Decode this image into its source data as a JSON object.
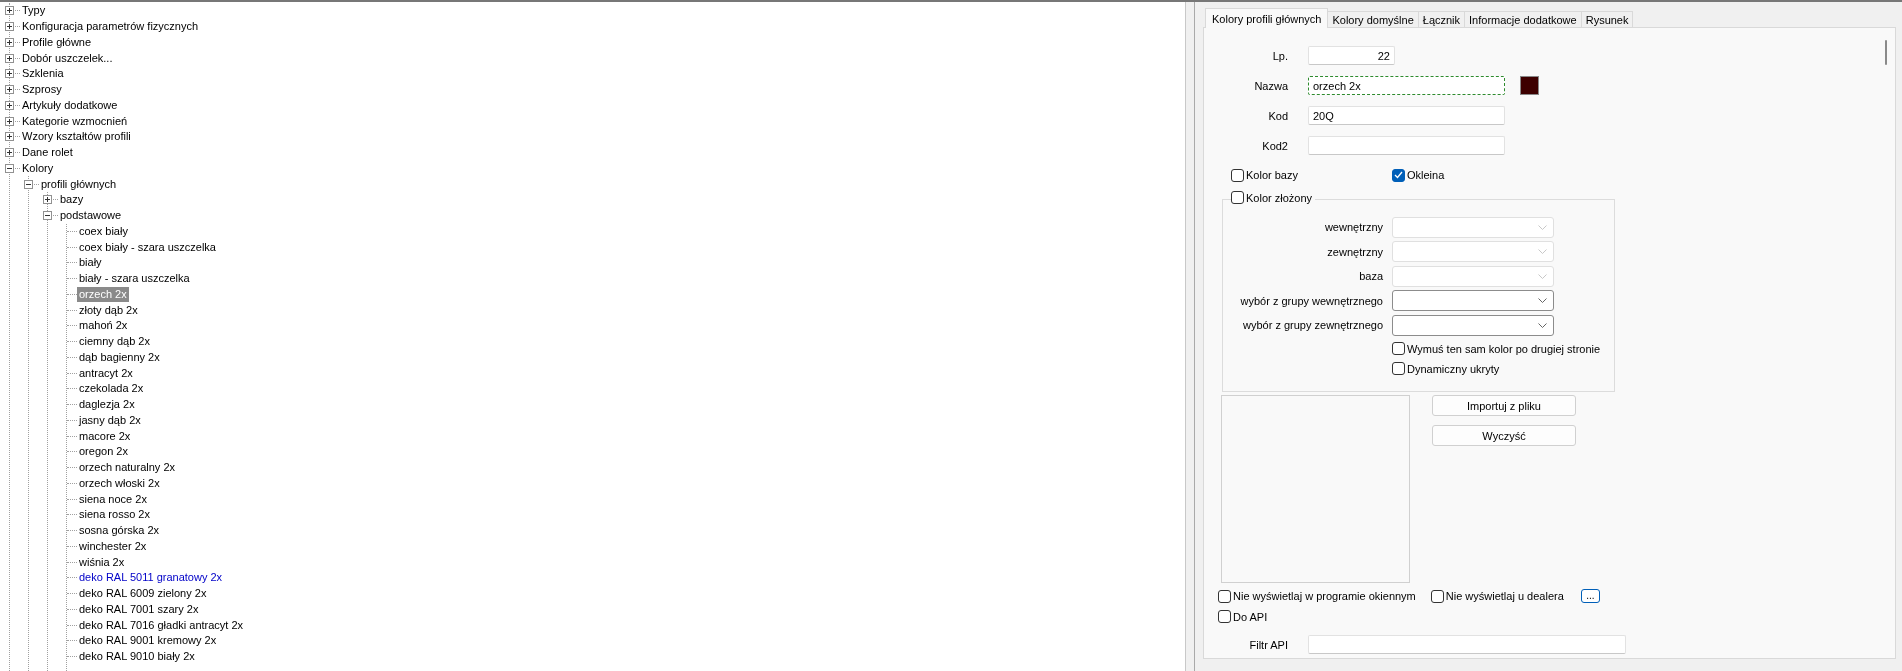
{
  "tree": [
    {
      "label": "Typy",
      "expanded": false,
      "selected": false,
      "highlighted": false
    },
    {
      "label": "Konfiguracja parametrów fizycznych",
      "expanded": false,
      "selected": false,
      "highlighted": false
    },
    {
      "label": "Profile główne",
      "expanded": false,
      "selected": false,
      "highlighted": false
    },
    {
      "label": "Dobór uszczelek...",
      "expanded": false,
      "selected": false,
      "highlighted": false
    },
    {
      "label": "Szklenia",
      "expanded": false,
      "selected": false,
      "highlighted": false
    },
    {
      "label": "Szprosy",
      "expanded": false,
      "selected": false,
      "highlighted": false
    },
    {
      "label": "Artykuły dodatkowe",
      "expanded": false,
      "selected": false,
      "highlighted": false
    },
    {
      "label": "Kategorie wzmocnień",
      "expanded": false,
      "selected": false,
      "highlighted": false
    },
    {
      "label": "Wzory kształtów profili",
      "expanded": false,
      "selected": false,
      "highlighted": false
    },
    {
      "label": "Dane rolet",
      "expanded": false,
      "selected": false,
      "highlighted": false
    },
    {
      "label": "Kolory",
      "expanded": true,
      "selected": false,
      "highlighted": false,
      "children": [
        {
          "label": "profili głównych",
          "expanded": true,
          "selected": false,
          "highlighted": false,
          "children": [
            {
              "label": "bazy",
              "expanded": false,
              "selected": false,
              "highlighted": false
            },
            {
              "label": "podstawowe",
              "expanded": true,
              "selected": false,
              "highlighted": false,
              "children": [
                {
                  "label": "coex biały",
                  "selected": false,
                  "highlighted": false
                },
                {
                  "label": "coex biały - szara uszczelka",
                  "selected": false,
                  "highlighted": false
                },
                {
                  "label": "biały",
                  "selected": false,
                  "highlighted": false
                },
                {
                  "label": "biały - szara uszczelka",
                  "selected": false,
                  "highlighted": false
                },
                {
                  "label": "orzech 2x",
                  "selected": true,
                  "highlighted": false
                },
                {
                  "label": "złoty dąb 2x",
                  "selected": false,
                  "highlighted": false
                },
                {
                  "label": "mahoń 2x",
                  "selected": false,
                  "highlighted": false
                },
                {
                  "label": "ciemny dąb 2x",
                  "selected": false,
                  "highlighted": false
                },
                {
                  "label": "dąb bagienny 2x",
                  "selected": false,
                  "highlighted": false
                },
                {
                  "label": "antracyt 2x",
                  "selected": false,
                  "highlighted": false
                },
                {
                  "label": "czekolada 2x",
                  "selected": false,
                  "highlighted": false
                },
                {
                  "label": "daglezja 2x",
                  "selected": false,
                  "highlighted": false
                },
                {
                  "label": "jasny dąb 2x",
                  "selected": false,
                  "highlighted": false
                },
                {
                  "label": "macore 2x",
                  "selected": false,
                  "highlighted": false
                },
                {
                  "label": "oregon 2x",
                  "selected": false,
                  "highlighted": false
                },
                {
                  "label": "orzech naturalny 2x",
                  "selected": false,
                  "highlighted": false
                },
                {
                  "label": "orzech włoski 2x",
                  "selected": false,
                  "highlighted": false
                },
                {
                  "label": "siena noce 2x",
                  "selected": false,
                  "highlighted": false
                },
                {
                  "label": "siena rosso 2x",
                  "selected": false,
                  "highlighted": false
                },
                {
                  "label": "sosna górska 2x",
                  "selected": false,
                  "highlighted": false
                },
                {
                  "label": "winchester 2x",
                  "selected": false,
                  "highlighted": false
                },
                {
                  "label": "wiśnia 2x",
                  "selected": false,
                  "highlighted": false
                },
                {
                  "label": "deko RAL 5011 granatowy 2x",
                  "selected": false,
                  "highlighted": true
                },
                {
                  "label": "deko RAL 6009 zielony 2x",
                  "selected": false,
                  "highlighted": false
                },
                {
                  "label": "deko RAL 7001 szary 2x",
                  "selected": false,
                  "highlighted": false
                },
                {
                  "label": "deko RAL 7016 gładki antracyt 2x",
                  "selected": false,
                  "highlighted": false
                },
                {
                  "label": "deko RAL 9001 kremowy 2x",
                  "selected": false,
                  "highlighted": false
                },
                {
                  "label": "deko RAL 9010 biały 2x",
                  "selected": false,
                  "highlighted": false
                }
              ]
            }
          ]
        }
      ]
    }
  ],
  "panel": {
    "tabs": [
      {
        "label": "Kolory profili głównych",
        "selected": true
      },
      {
        "label": "Kolory domyślne",
        "selected": false
      },
      {
        "label": "Łącznik",
        "selected": false
      },
      {
        "label": "Informacje dodatkowe",
        "selected": false
      },
      {
        "label": "Rysunek",
        "selected": false
      }
    ],
    "fields": [
      {
        "kind": "number",
        "label": "Lp.",
        "value": "22"
      },
      {
        "kind": "name",
        "label": "Nazwa",
        "value": "orzech 2x",
        "focused": true,
        "color": "#3d0000"
      },
      {
        "kind": "text",
        "label": "Kod",
        "value": "20Q"
      },
      {
        "kind": "text",
        "label": "Kod2"
      }
    ],
    "color_options": [
      {
        "label": "Kolor bazy",
        "checked": false
      },
      {
        "label": "Okleina",
        "checked": true
      }
    ],
    "composite": {
      "label": "Kolor złożony",
      "checked": false,
      "combos": [
        {
          "label": "wewnętrzny",
          "disabled": true
        },
        {
          "label": "zewnętrzny",
          "disabled": true
        },
        {
          "label": "baza",
          "disabled": true
        },
        {
          "label": "wybór z grupy wewnętrznego",
          "disabled": false
        },
        {
          "label": "wybór z grupy zewnętrznego",
          "disabled": false
        }
      ],
      "options": [
        {
          "label": "Wymuś ten sam kolor po drugiej stronie",
          "checked": false
        },
        {
          "label": "Dynamiczny ukryty",
          "checked": false
        }
      ]
    },
    "buttons": [
      "Importuj z pliku",
      "Wyczyść"
    ],
    "display_options": [
      {
        "label": "Nie wyświetlaj w programie okiennym",
        "checked": false
      },
      {
        "label": "Nie wyświetlaj u dealera",
        "checked": false
      }
    ],
    "more_button": "...",
    "api_option": {
      "label": "Do API",
      "checked": false
    },
    "api_filter": {
      "label": "Filtr API"
    }
  }
}
